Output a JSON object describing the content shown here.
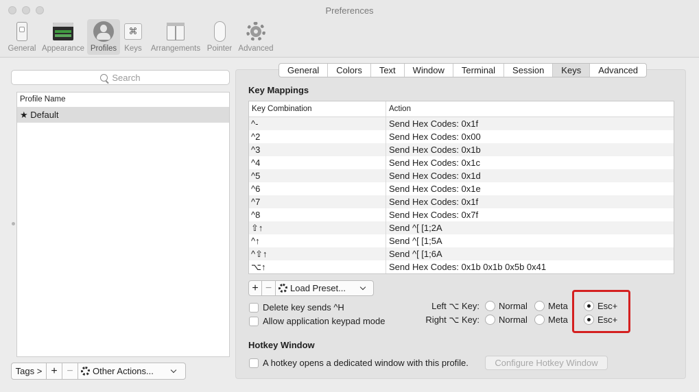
{
  "window": {
    "title": "Preferences"
  },
  "toolbar": {
    "items": [
      {
        "label": "General",
        "icon": "general-switch-icon"
      },
      {
        "label": "Appearance",
        "icon": "appearance-window-icon"
      },
      {
        "label": "Profiles",
        "icon": "profiles-person-icon",
        "selected": true
      },
      {
        "label": "Keys",
        "icon": "keys-command-icon"
      },
      {
        "label": "Arrangements",
        "icon": "arrangements-window-icon"
      },
      {
        "label": "Pointer",
        "icon": "pointer-mouse-icon"
      },
      {
        "label": "Advanced",
        "icon": "advanced-gear-icon"
      }
    ],
    "keys_glyph": "⌘"
  },
  "profiles": {
    "search_placeholder": "Search",
    "column_header": "Profile Name",
    "items": [
      {
        "label": "★ Default"
      }
    ],
    "tags_label": "Tags >",
    "add_label": "+",
    "remove_label": "−",
    "other_actions_label": "Other Actions..."
  },
  "tabs": [
    {
      "label": "General"
    },
    {
      "label": "Colors"
    },
    {
      "label": "Text"
    },
    {
      "label": "Window"
    },
    {
      "label": "Terminal"
    },
    {
      "label": "Session"
    },
    {
      "label": "Keys",
      "active": true
    },
    {
      "label": "Advanced"
    }
  ],
  "key_mappings": {
    "title": "Key Mappings",
    "columns": [
      "Key Combination",
      "Action"
    ],
    "rows": [
      {
        "key": "^-",
        "action": "Send Hex Codes: 0x1f"
      },
      {
        "key": "^2",
        "action": "Send Hex Codes: 0x00"
      },
      {
        "key": "^3",
        "action": "Send Hex Codes: 0x1b"
      },
      {
        "key": "^4",
        "action": "Send Hex Codes: 0x1c"
      },
      {
        "key": "^5",
        "action": "Send Hex Codes: 0x1d"
      },
      {
        "key": "^6",
        "action": "Send Hex Codes: 0x1e"
      },
      {
        "key": "^7",
        "action": "Send Hex Codes: 0x1f"
      },
      {
        "key": "^8",
        "action": "Send Hex Codes: 0x7f"
      },
      {
        "key": "⇧↑",
        "action": "Send ^[ [1;2A"
      },
      {
        "key": "^↑",
        "action": "Send ^[ [1;5A"
      },
      {
        "key": "^⇧↑",
        "action": "Send ^[ [1;6A"
      },
      {
        "key": "⌥↑",
        "action": "Send Hex Codes: 0x1b 0x1b 0x5b 0x41"
      }
    ],
    "add_label": "+",
    "remove_label": "−",
    "load_preset_label": "Load Preset..."
  },
  "options": {
    "delete_key_label": "Delete key sends ^H",
    "keypad_label": "Allow application keypad mode",
    "left_option_label": "Left ⌥ Key:",
    "right_option_label": "Right ⌥ Key:",
    "radio_labels": [
      "Normal",
      "Meta",
      "Esc+"
    ],
    "left_selected": "Esc+",
    "right_selected": "Esc+"
  },
  "hotkey": {
    "title": "Hotkey Window",
    "checkbox_label": "A hotkey opens a dedicated window with this profile.",
    "configure_label": "Configure Hotkey Window"
  },
  "colors": {
    "highlight": "#d42020"
  }
}
